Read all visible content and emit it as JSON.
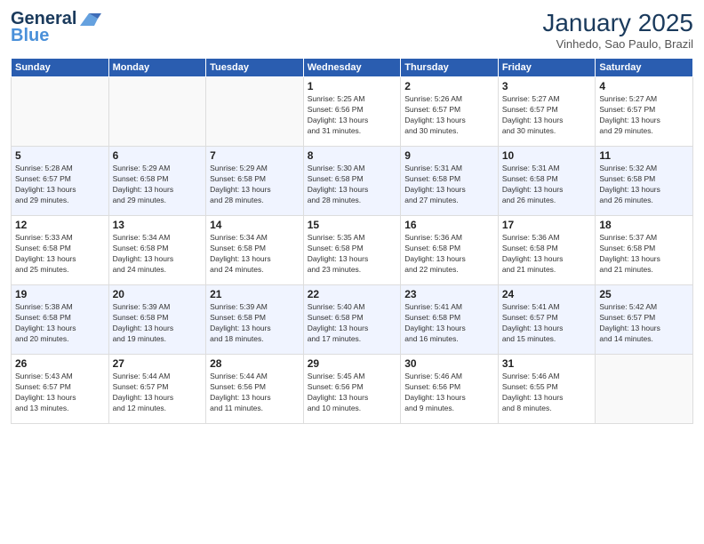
{
  "header": {
    "logo_line1": "General",
    "logo_line2": "Blue",
    "month": "January 2025",
    "location": "Vinhedo, Sao Paulo, Brazil"
  },
  "weekdays": [
    "Sunday",
    "Monday",
    "Tuesday",
    "Wednesday",
    "Thursday",
    "Friday",
    "Saturday"
  ],
  "weeks": [
    [
      {
        "day": "",
        "info": ""
      },
      {
        "day": "",
        "info": ""
      },
      {
        "day": "",
        "info": ""
      },
      {
        "day": "1",
        "info": "Sunrise: 5:25 AM\nSunset: 6:56 PM\nDaylight: 13 hours\nand 31 minutes."
      },
      {
        "day": "2",
        "info": "Sunrise: 5:26 AM\nSunset: 6:57 PM\nDaylight: 13 hours\nand 30 minutes."
      },
      {
        "day": "3",
        "info": "Sunrise: 5:27 AM\nSunset: 6:57 PM\nDaylight: 13 hours\nand 30 minutes."
      },
      {
        "day": "4",
        "info": "Sunrise: 5:27 AM\nSunset: 6:57 PM\nDaylight: 13 hours\nand 29 minutes."
      }
    ],
    [
      {
        "day": "5",
        "info": "Sunrise: 5:28 AM\nSunset: 6:57 PM\nDaylight: 13 hours\nand 29 minutes."
      },
      {
        "day": "6",
        "info": "Sunrise: 5:29 AM\nSunset: 6:58 PM\nDaylight: 13 hours\nand 29 minutes."
      },
      {
        "day": "7",
        "info": "Sunrise: 5:29 AM\nSunset: 6:58 PM\nDaylight: 13 hours\nand 28 minutes."
      },
      {
        "day": "8",
        "info": "Sunrise: 5:30 AM\nSunset: 6:58 PM\nDaylight: 13 hours\nand 28 minutes."
      },
      {
        "day": "9",
        "info": "Sunrise: 5:31 AM\nSunset: 6:58 PM\nDaylight: 13 hours\nand 27 minutes."
      },
      {
        "day": "10",
        "info": "Sunrise: 5:31 AM\nSunset: 6:58 PM\nDaylight: 13 hours\nand 26 minutes."
      },
      {
        "day": "11",
        "info": "Sunrise: 5:32 AM\nSunset: 6:58 PM\nDaylight: 13 hours\nand 26 minutes."
      }
    ],
    [
      {
        "day": "12",
        "info": "Sunrise: 5:33 AM\nSunset: 6:58 PM\nDaylight: 13 hours\nand 25 minutes."
      },
      {
        "day": "13",
        "info": "Sunrise: 5:34 AM\nSunset: 6:58 PM\nDaylight: 13 hours\nand 24 minutes."
      },
      {
        "day": "14",
        "info": "Sunrise: 5:34 AM\nSunset: 6:58 PM\nDaylight: 13 hours\nand 24 minutes."
      },
      {
        "day": "15",
        "info": "Sunrise: 5:35 AM\nSunset: 6:58 PM\nDaylight: 13 hours\nand 23 minutes."
      },
      {
        "day": "16",
        "info": "Sunrise: 5:36 AM\nSunset: 6:58 PM\nDaylight: 13 hours\nand 22 minutes."
      },
      {
        "day": "17",
        "info": "Sunrise: 5:36 AM\nSunset: 6:58 PM\nDaylight: 13 hours\nand 21 minutes."
      },
      {
        "day": "18",
        "info": "Sunrise: 5:37 AM\nSunset: 6:58 PM\nDaylight: 13 hours\nand 21 minutes."
      }
    ],
    [
      {
        "day": "19",
        "info": "Sunrise: 5:38 AM\nSunset: 6:58 PM\nDaylight: 13 hours\nand 20 minutes."
      },
      {
        "day": "20",
        "info": "Sunrise: 5:39 AM\nSunset: 6:58 PM\nDaylight: 13 hours\nand 19 minutes."
      },
      {
        "day": "21",
        "info": "Sunrise: 5:39 AM\nSunset: 6:58 PM\nDaylight: 13 hours\nand 18 minutes."
      },
      {
        "day": "22",
        "info": "Sunrise: 5:40 AM\nSunset: 6:58 PM\nDaylight: 13 hours\nand 17 minutes."
      },
      {
        "day": "23",
        "info": "Sunrise: 5:41 AM\nSunset: 6:58 PM\nDaylight: 13 hours\nand 16 minutes."
      },
      {
        "day": "24",
        "info": "Sunrise: 5:41 AM\nSunset: 6:57 PM\nDaylight: 13 hours\nand 15 minutes."
      },
      {
        "day": "25",
        "info": "Sunrise: 5:42 AM\nSunset: 6:57 PM\nDaylight: 13 hours\nand 14 minutes."
      }
    ],
    [
      {
        "day": "26",
        "info": "Sunrise: 5:43 AM\nSunset: 6:57 PM\nDaylight: 13 hours\nand 13 minutes."
      },
      {
        "day": "27",
        "info": "Sunrise: 5:44 AM\nSunset: 6:57 PM\nDaylight: 13 hours\nand 12 minutes."
      },
      {
        "day": "28",
        "info": "Sunrise: 5:44 AM\nSunset: 6:56 PM\nDaylight: 13 hours\nand 11 minutes."
      },
      {
        "day": "29",
        "info": "Sunrise: 5:45 AM\nSunset: 6:56 PM\nDaylight: 13 hours\nand 10 minutes."
      },
      {
        "day": "30",
        "info": "Sunrise: 5:46 AM\nSunset: 6:56 PM\nDaylight: 13 hours\nand 9 minutes."
      },
      {
        "day": "31",
        "info": "Sunrise: 5:46 AM\nSunset: 6:55 PM\nDaylight: 13 hours\nand 8 minutes."
      },
      {
        "day": "",
        "info": ""
      }
    ]
  ]
}
